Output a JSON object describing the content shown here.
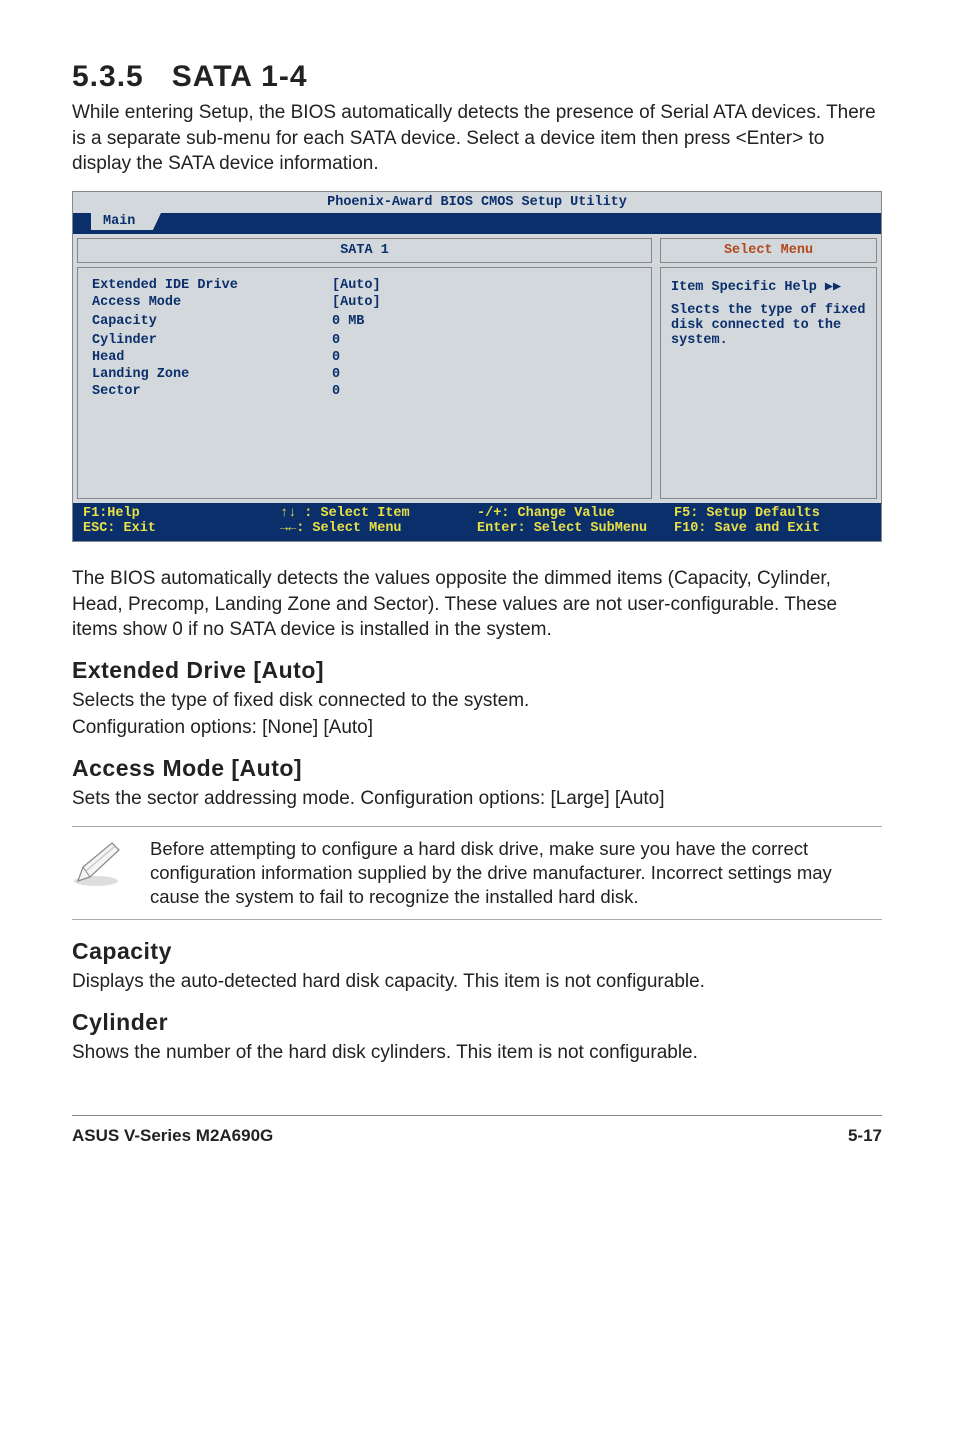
{
  "heading": {
    "number": "5.3.5",
    "title": "SATA 1-4"
  },
  "intro_paragraph": "While entering Setup, the BIOS automatically detects the presence of Serial ATA devices. There is a separate sub-menu for each SATA device. Select a device item then press <Enter> to display the SATA device information.",
  "bios": {
    "utility_title": "Phoenix-Award BIOS CMOS Setup Utility",
    "tab": "Main",
    "left_heading": "SATA 1",
    "right_heading": "Select Menu",
    "items": [
      {
        "label": "Extended IDE Drive",
        "value": "[Auto]"
      },
      {
        "label": "Access Mode",
        "value": "[Auto]"
      },
      {
        "label": "",
        "value": ""
      },
      {
        "label": "Capacity",
        "value": "0 MB"
      },
      {
        "label": "",
        "value": ""
      },
      {
        "label": "Cylinder",
        "value": "0"
      },
      {
        "label": "Head",
        "value": "0"
      },
      {
        "label": "Landing Zone",
        "value": "0"
      },
      {
        "label": "Sector",
        "value": "0"
      }
    ],
    "help_title": "Item Specific Help ▶▶",
    "help_body": "Slects the type of fixed disk connected to the system.",
    "footer": {
      "col1": "F1:Help\nESC: Exit",
      "col2": "↑↓ : Select Item\n→←: Select Menu",
      "col3": "-/+: Change Value\nEnter: Select SubMenu",
      "col4": "F5: Setup Defaults\nF10: Save and Exit"
    }
  },
  "post_bios_paragraph": "The BIOS automatically detects the values opposite the dimmed items (Capacity, Cylinder,  Head, Precomp, Landing Zone and Sector). These values are not user-configurable. These items show 0 if no SATA device is installed in the system.",
  "sections": {
    "extended_drive": {
      "heading": "Extended Drive [Auto]",
      "line1": "Selects the type of fixed disk connected to the system.",
      "line2": "Configuration options: [None] [Auto]"
    },
    "access_mode": {
      "heading": "Access Mode [Auto]",
      "body": "Sets the sector addressing mode. Configuration options: [Large] [Auto]"
    },
    "note": "Before attempting to configure a hard disk drive, make sure you have the correct configuration information supplied by the drive manufacturer. Incorrect settings may cause the system to fail to recognize the installed hard disk.",
    "capacity": {
      "heading": "Capacity",
      "body": "Displays the auto-detected hard disk capacity. This item is not configurable."
    },
    "cylinder": {
      "heading": "Cylinder",
      "body": "Shows the number of the hard disk cylinders. This item is not configurable."
    }
  },
  "footer": {
    "left": "ASUS V-Series M2A690G",
    "right": "5-17"
  }
}
